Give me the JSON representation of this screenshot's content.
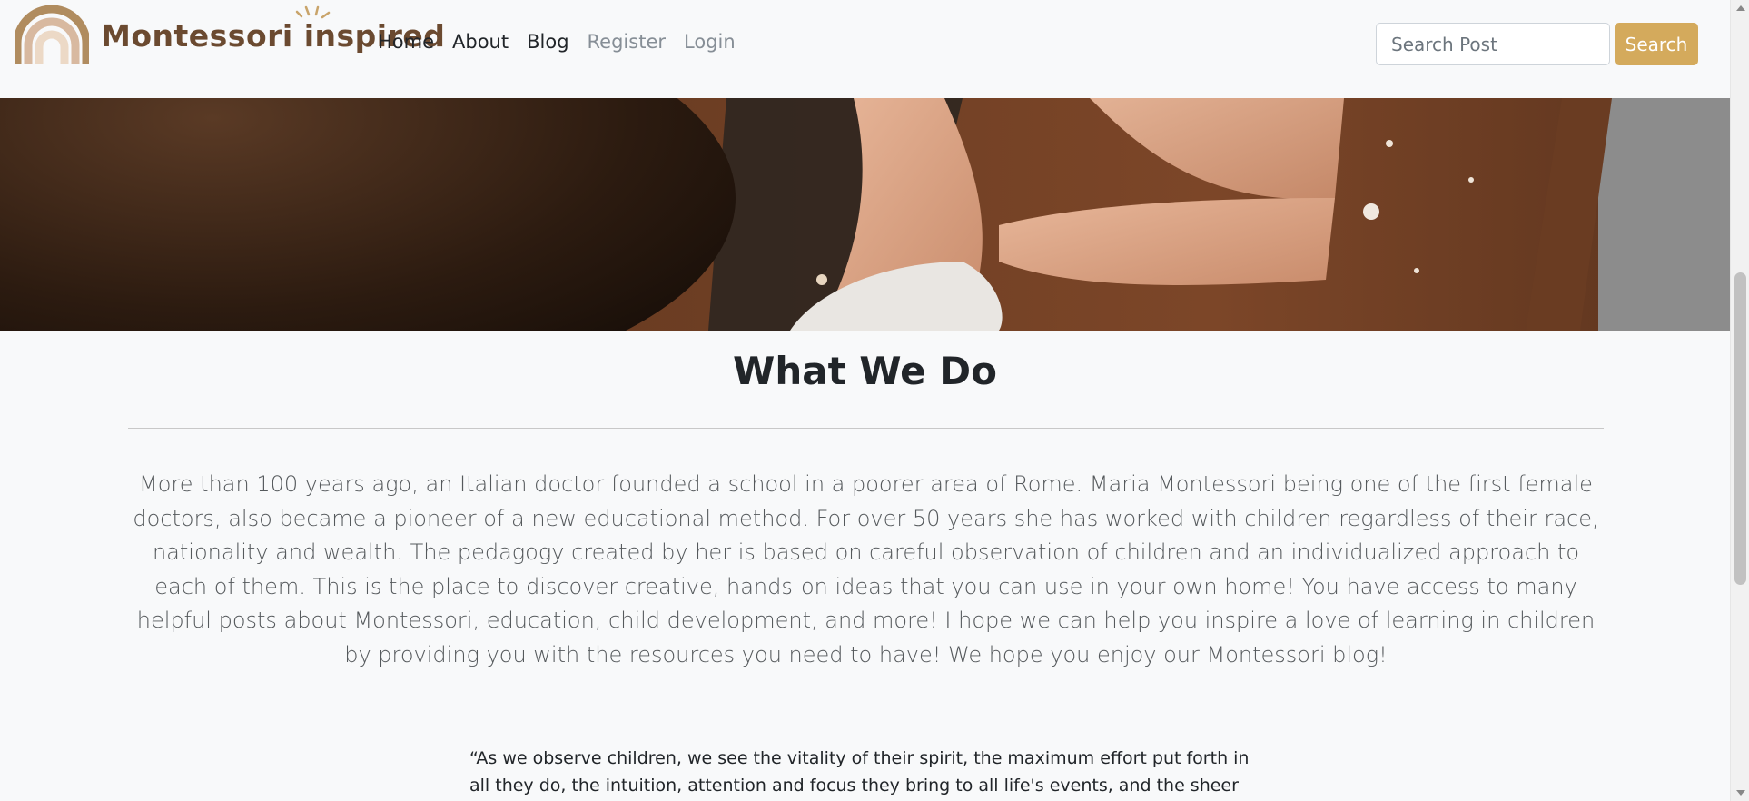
{
  "brand": {
    "name": "Montessori inspired",
    "color": "#6b4a30"
  },
  "nav": {
    "links": [
      {
        "label": "Home"
      },
      {
        "label": "About"
      },
      {
        "label": "Blog"
      },
      {
        "label": "Register"
      },
      {
        "label": "Login"
      }
    ]
  },
  "search": {
    "placeholder": "Search Post",
    "value": "",
    "button_label": "Search",
    "button_color": "#d4aa5c"
  },
  "main": {
    "title": "What We Do",
    "paragraph": "More than 100 years ago, an Italian doctor founded a school in a poorer area of Rome. Maria Montessori being one of the first female doctors, also became a pioneer of a new educational method. For over 50 years she has worked with children regardless of their race, nationality and wealth. The pedagogy created by her is based on careful observation of children and an individualized approach to each of them. This is the place to discover creative, hands-on ideas that you can use in your own home! You have access to many helpful posts about Montessori, education, child development, and more! I hope we can help you inspire a love of learning in children by providing you with the resources you need to have! We hope you enjoy our Montessori blog!",
    "quote": "“As we observe children, we see the vitality of their spirit, the maximum effort put forth in all they do, the intuition, attention and focus they bring to all life's events, and the sheer joy they"
  }
}
